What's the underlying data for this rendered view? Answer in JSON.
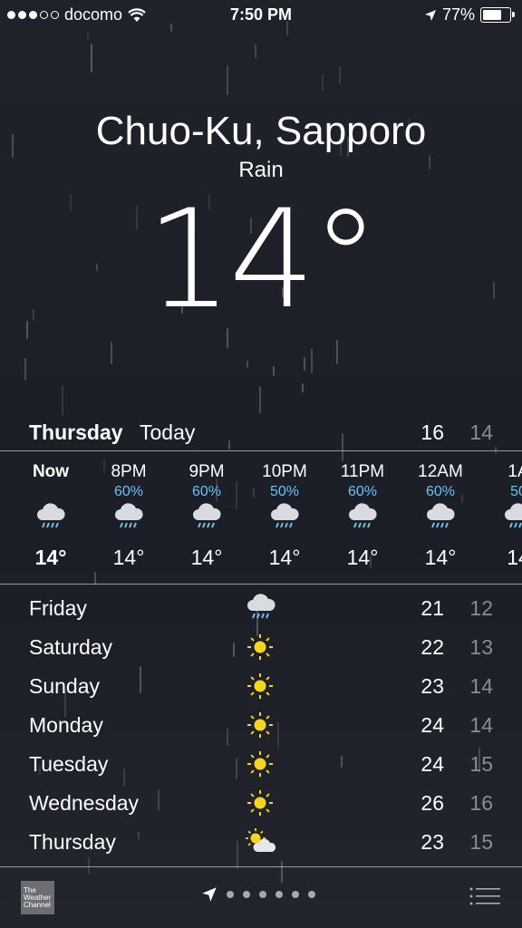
{
  "status_bar": {
    "carrier": "docomo",
    "time": "7:50 PM",
    "battery": "77%",
    "battery_level": 0.77
  },
  "location": {
    "city": "Chuo-Ku, Sapporo",
    "condition": "Rain",
    "temperature": "14°"
  },
  "today": {
    "day": "Thursday",
    "label": "Today",
    "high": "16",
    "low": "14"
  },
  "hourly": [
    {
      "hour": "Now",
      "precip": "",
      "icon": "rain-cloud-icon",
      "temp": "14°"
    },
    {
      "hour": "8PM",
      "precip": "60%",
      "icon": "rain-cloud-icon",
      "temp": "14°"
    },
    {
      "hour": "9PM",
      "precip": "60%",
      "icon": "rain-cloud-icon",
      "temp": "14°"
    },
    {
      "hour": "10PM",
      "precip": "50%",
      "icon": "rain-cloud-icon",
      "temp": "14°"
    },
    {
      "hour": "11PM",
      "precip": "60%",
      "icon": "rain-cloud-icon",
      "temp": "14°"
    },
    {
      "hour": "12AM",
      "precip": "60%",
      "icon": "rain-cloud-icon",
      "temp": "14°"
    },
    {
      "hour": "1A",
      "precip": "50",
      "icon": "rain-cloud-icon",
      "temp": "14"
    }
  ],
  "daily": [
    {
      "day": "Friday",
      "icon": "rain-cloud-icon",
      "high": "21",
      "low": "12"
    },
    {
      "day": "Saturday",
      "icon": "sun-icon",
      "high": "22",
      "low": "13"
    },
    {
      "day": "Sunday",
      "icon": "sun-icon",
      "high": "23",
      "low": "14"
    },
    {
      "day": "Monday",
      "icon": "sun-icon",
      "high": "24",
      "low": "14"
    },
    {
      "day": "Tuesday",
      "icon": "sun-icon",
      "high": "24",
      "low": "15"
    },
    {
      "day": "Wednesday",
      "icon": "sun-icon",
      "high": "26",
      "low": "16"
    },
    {
      "day": "Thursday",
      "icon": "partly-cloudy-icon",
      "high": "23",
      "low": "15"
    }
  ],
  "bottom_bar": {
    "logo_line1": "The",
    "logo_line2": "Weather",
    "logo_line3": "Channel",
    "pages": 6
  },
  "colors": {
    "background": "#1e2029",
    "precip": "#6fc1ef",
    "low_temp": "#8a8c94",
    "sun": "#f7d51c"
  }
}
